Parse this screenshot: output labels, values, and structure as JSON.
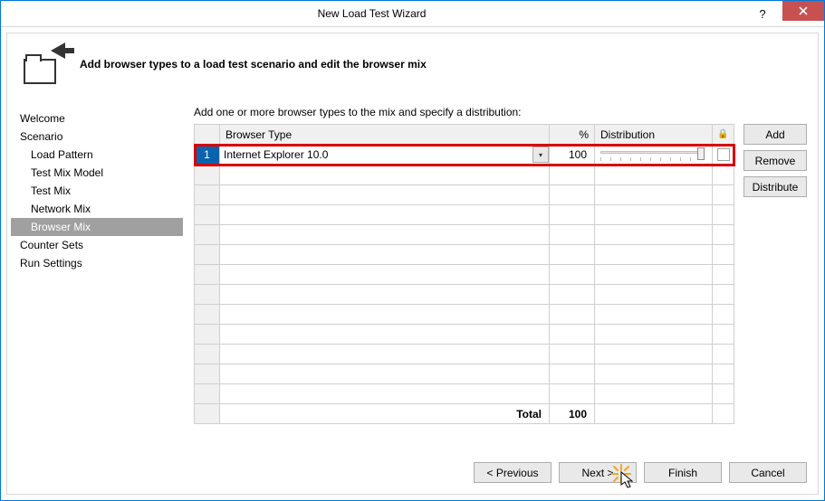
{
  "window": {
    "title": "New Load Test Wizard"
  },
  "header": {
    "instruction": "Add browser types to a load test scenario and edit the browser mix"
  },
  "nav": {
    "items": [
      {
        "label": "Welcome",
        "indent": 0,
        "selected": false
      },
      {
        "label": "Scenario",
        "indent": 0,
        "selected": false
      },
      {
        "label": "Load Pattern",
        "indent": 1,
        "selected": false
      },
      {
        "label": "Test Mix Model",
        "indent": 1,
        "selected": false
      },
      {
        "label": "Test Mix",
        "indent": 1,
        "selected": false
      },
      {
        "label": "Network Mix",
        "indent": 1,
        "selected": false
      },
      {
        "label": "Browser Mix",
        "indent": 1,
        "selected": true
      },
      {
        "label": "Counter Sets",
        "indent": 0,
        "selected": false
      },
      {
        "label": "Run Settings",
        "indent": 0,
        "selected": false
      }
    ]
  },
  "main": {
    "caption": "Add one or more browser types to the mix and specify a distribution:",
    "columns": {
      "browser_type": "Browser Type",
      "percent": "%",
      "distribution": "Distribution",
      "lock": "🔒"
    },
    "rows": [
      {
        "index": "1",
        "browser": "Internet Explorer 10.0",
        "percent": "100",
        "slider": 100,
        "locked": false
      }
    ],
    "blank_rows": 12,
    "footer": {
      "label": "Total",
      "percent": "100"
    }
  },
  "side_buttons": {
    "add": "Add",
    "remove": "Remove",
    "distribute": "Distribute"
  },
  "wizard_buttons": {
    "previous": "< Previous",
    "next": "Next >",
    "finish": "Finish",
    "cancel": "Cancel"
  }
}
